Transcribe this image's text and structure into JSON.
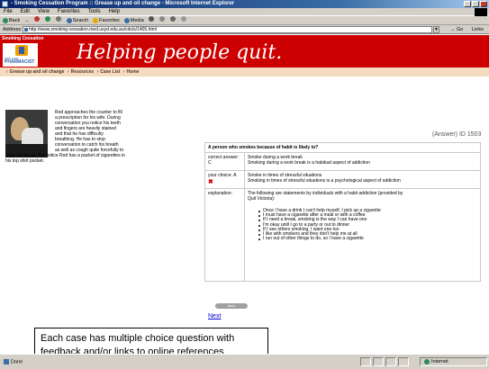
{
  "window": {
    "title": "- Smoking Cessation Program :: Grease up and oil change - Microsoft Internet Explorer"
  },
  "menu": [
    "File",
    "Edit",
    "View",
    "Favorites",
    "Tools",
    "Help"
  ],
  "toolbar": [
    "Back",
    "→",
    "Search",
    "Favorites",
    "Media"
  ],
  "address": {
    "label": "Address",
    "url": "http://www.smoking-cessation.med.usyd.edu.au/cds/s/1405.html",
    "go": "Go",
    "links": "Links"
  },
  "site": {
    "tag": "Smoking Cessation",
    "logo_ask": "Ask your",
    "logo_name": "PHARMACIST",
    "headline": "Helping people quit.",
    "nav": [
      "Grease up and oil change",
      "Resources",
      "Case List",
      "Home"
    ]
  },
  "narrative": {
    "lines": [
      "Rod approaches the counter to fill",
      "a prescription for his wife. During",
      "conversation you notice his teeth",
      "and fingers are heavily stained",
      "and that he has difficulty",
      "breathing. He has to stop",
      "conversation to catch his breath",
      "as well as cough quite forcefully to",
      "clear his throat. You notice Rod has a packet of cigarettes in",
      "his top shirt pocket."
    ]
  },
  "answer_id": "(Answer) ID 1503",
  "question": {
    "text": "A person who smokes because of habit is likely to?",
    "correct_label": "correct answer: C",
    "correct_lines": [
      "Smoke during a work break",
      "Smoking during a work break is a habitual aspect of addiction"
    ],
    "choice_label": "your choice: A",
    "choice_mark": "✖",
    "choice_lines": [
      "Smoke in times of stressful situations",
      "Smoking in times of stressful situations is a psychological aspect of addiction"
    ],
    "explanation_label": "explanation:",
    "explanation_intro": [
      "The following are statements by individuals with a habit addiction (provided by",
      "Quit Victoria):"
    ],
    "explanation_items": [
      "Once I have a drink I can't help myself, I pick up a cigarette",
      "I must have a cigarette after a meal or with a coffee",
      "If I need a break, smoking is the way I can have one",
      "I'm okay until I go to a party or out to dinner",
      "If I see others smoking, I want one too",
      "I like with smokers and they don't help me at all",
      "I run out of other things to do, so I have a cigarette"
    ]
  },
  "back_label": "back",
  "next_label": "Next",
  "caption_text": "Each case has multiple choice question with feedback and/or links to online references",
  "status": {
    "left": "Done",
    "zone": "Internet"
  }
}
